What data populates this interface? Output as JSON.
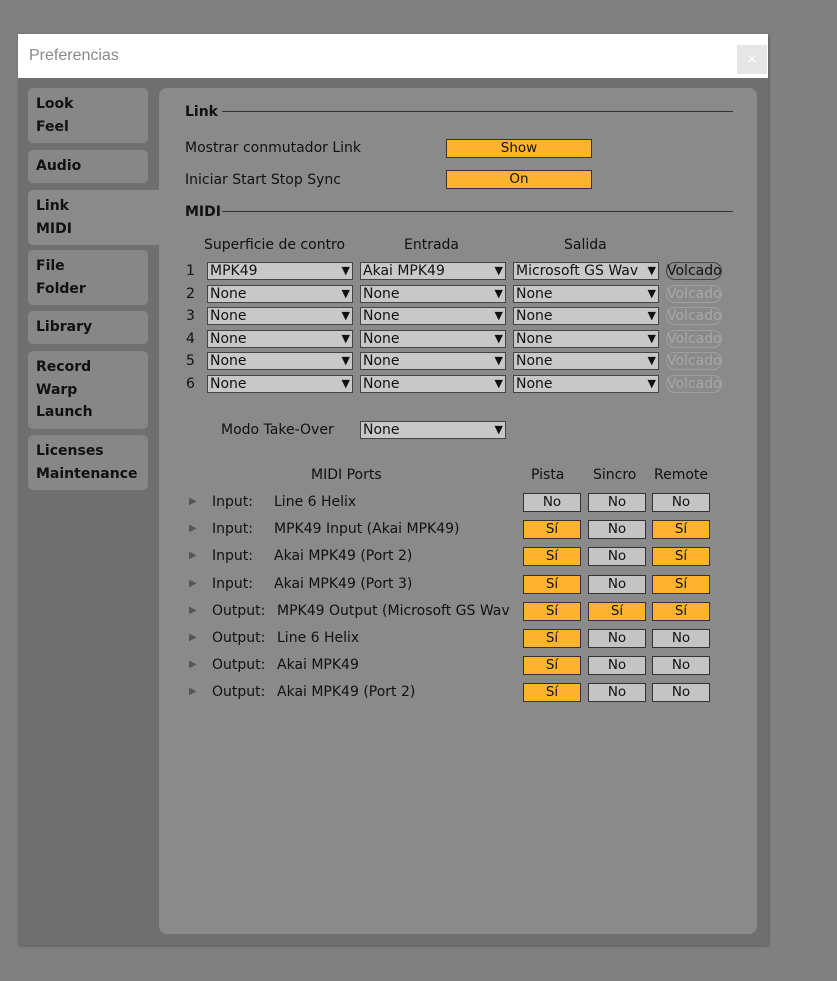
{
  "window": {
    "title": "Preferencias",
    "close": "×"
  },
  "sidebar": {
    "tabs": [
      [
        "Look",
        "Feel"
      ],
      [
        "Audio"
      ],
      [
        "Link",
        "MIDI"
      ],
      [
        "File",
        "Folder"
      ],
      [
        "Library"
      ],
      [
        "Record",
        "Warp",
        "Launch"
      ],
      [
        "Licenses",
        "Maintenance"
      ]
    ],
    "selected": 2
  },
  "link": {
    "header": "Link",
    "show_label": "Mostrar conmutador Link",
    "show_value": "Show",
    "sync_label": "Iniciar Start Stop Sync",
    "sync_value": "On"
  },
  "midi": {
    "header": "MIDI",
    "col_surface": "Superficie de contro",
    "col_input": "Entrada",
    "col_output": "Salida",
    "rows": [
      {
        "n": "1",
        "surface": "MPK49",
        "input": "Akai MPK49",
        "output": "Microsoft GS Wav",
        "dump": "Volcado",
        "enabled": true
      },
      {
        "n": "2",
        "surface": "None",
        "input": "None",
        "output": "None",
        "dump": "Volcado",
        "enabled": false
      },
      {
        "n": "3",
        "surface": "None",
        "input": "None",
        "output": "None",
        "dump": "Volcado",
        "enabled": false
      },
      {
        "n": "4",
        "surface": "None",
        "input": "None",
        "output": "None",
        "dump": "Volcado",
        "enabled": false
      },
      {
        "n": "5",
        "surface": "None",
        "input": "None",
        "output": "None",
        "dump": "Volcado",
        "enabled": false
      },
      {
        "n": "6",
        "surface": "None",
        "input": "None",
        "output": "None",
        "dump": "Volcado",
        "enabled": false
      }
    ],
    "takeover_label": "Modo Take-Over",
    "takeover_value": "None"
  },
  "ports": {
    "header": "MIDI Ports",
    "col_track": "Pista",
    "col_sync": "Sincro",
    "col_remote": "Remote",
    "rows": [
      {
        "type": "Input:",
        "name": "Line 6 Helix",
        "track": "No",
        "sync": "No",
        "remote": "No"
      },
      {
        "type": "Input:",
        "name": "MPK49 Input (Akai MPK49)",
        "track": "Sí",
        "sync": "No",
        "remote": "Sí"
      },
      {
        "type": "Input:",
        "name": "Akai MPK49 (Port 2)",
        "track": "Sí",
        "sync": "No",
        "remote": "Sí"
      },
      {
        "type": "Input:",
        "name": "Akai MPK49 (Port 3)",
        "track": "Sí",
        "sync": "No",
        "remote": "Sí"
      },
      {
        "type": "Output:",
        "name": "MPK49 Output (Microsoft GS Wav",
        "track": "Sí",
        "sync": "Sí",
        "remote": "Sí"
      },
      {
        "type": "Output:",
        "name": "Line 6 Helix",
        "track": "Sí",
        "sync": "No",
        "remote": "No"
      },
      {
        "type": "Output:",
        "name": "Akai MPK49",
        "track": "Sí",
        "sync": "No",
        "remote": "No"
      },
      {
        "type": "Output:",
        "name": "Akai MPK49 (Port 2)",
        "track": "Sí",
        "sync": "No",
        "remote": "No"
      }
    ]
  },
  "colors": {
    "accent": "#fdb32d",
    "off": "#c4c4c4",
    "panel": "#8a8a8a"
  }
}
